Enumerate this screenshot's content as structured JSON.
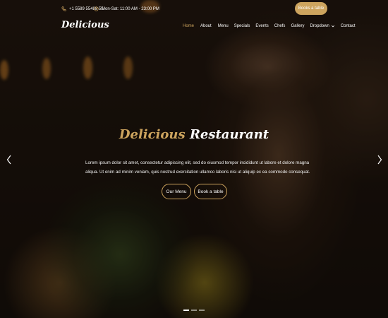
{
  "topbar": {
    "phone": "+1 5589 55488 55",
    "hours": "Mon-Sat: 11:00 AM - 23:00 PM",
    "book_label": "Books a table",
    "phone_icon": "phone-icon",
    "clock_icon": "clock-icon"
  },
  "logo": "Delicious",
  "nav": {
    "items": [
      {
        "label": "Home",
        "active": true
      },
      {
        "label": "About"
      },
      {
        "label": "Menu"
      },
      {
        "label": "Specials"
      },
      {
        "label": "Events"
      },
      {
        "label": "Chefs"
      },
      {
        "label": "Gallery"
      },
      {
        "label": "Dropdown",
        "has_dropdown": true
      },
      {
        "label": "Contact"
      }
    ]
  },
  "hero": {
    "title_accent": "Delicious",
    "title_rest": "Restaurant",
    "description": "Lorem ipsum dolor sit amet, consectetur adipiscing elit, sed do eiusmod tempor incididunt ut labore et dolore magna aliqua. Ut enim ad minim veniam, quis nostrud exercitation ullamco laboris nisi ut aliquip ex ea commodo consequat.",
    "btn_menu": "Our Menu",
    "btn_book": "Book a table"
  },
  "carousel": {
    "slides": 3,
    "active": 0
  },
  "colors": {
    "accent": "#cda45e"
  }
}
